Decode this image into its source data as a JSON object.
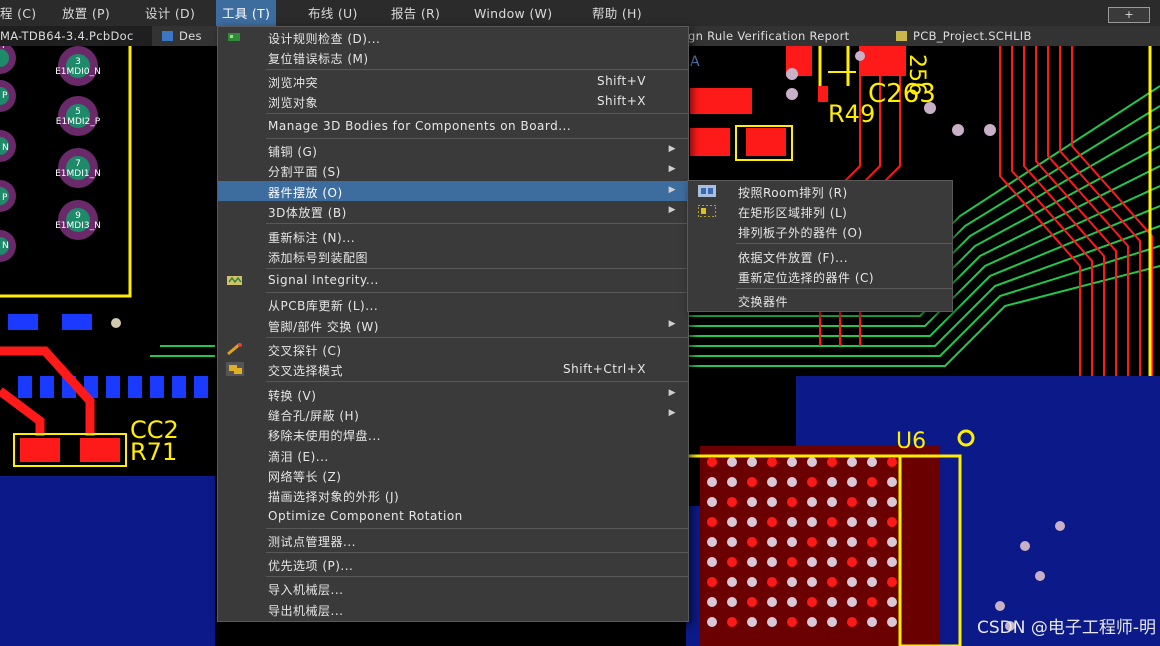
{
  "menubar": {
    "items": [
      "程 (C)",
      "放置 (P)",
      "设计 (D)",
      "工具 (T)",
      "布线 (U)",
      "报告 (R)",
      "Window (W)",
      "帮助 (H)"
    ],
    "window_button": "+"
  },
  "tabs": [
    {
      "label": "MA-TDB64-3.4.PcbDoc"
    },
    {
      "label": "Des"
    },
    {
      "label": "gn Rule Verification Report"
    },
    {
      "label": "PCB_Project.SCHLIB"
    }
  ],
  "tools_menu": {
    "items": [
      {
        "label": "设计规则检查 (D)...",
        "shortcut": "",
        "submenu": false
      },
      {
        "label": "复位错误标志 (M)",
        "shortcut": "",
        "submenu": false
      },
      {
        "label": "浏览冲突",
        "shortcut": "Shift+V",
        "submenu": false
      },
      {
        "label": "浏览对象",
        "shortcut": "Shift+X",
        "submenu": false
      },
      {
        "label": "Manage 3D Bodies for Components on Board...",
        "shortcut": "",
        "submenu": false
      },
      {
        "label": "铺铜 (G)",
        "shortcut": "",
        "submenu": true
      },
      {
        "label": "分割平面 (S)",
        "shortcut": "",
        "submenu": true
      },
      {
        "label": "器件摆放 (O)",
        "shortcut": "",
        "submenu": true
      },
      {
        "label": "3D体放置 (B)",
        "shortcut": "",
        "submenu": true
      },
      {
        "label": "重新标注 (N)...",
        "shortcut": "",
        "submenu": false
      },
      {
        "label": "添加标号到装配图",
        "shortcut": "",
        "submenu": false
      },
      {
        "label": "Signal Integrity...",
        "shortcut": "",
        "submenu": false
      },
      {
        "label": "从PCB库更新 (L)...",
        "shortcut": "",
        "submenu": false
      },
      {
        "label": "管脚/部件 交换 (W)",
        "shortcut": "",
        "submenu": true
      },
      {
        "label": "交叉探针 (C)",
        "shortcut": "",
        "submenu": false
      },
      {
        "label": "交叉选择模式",
        "shortcut": "Shift+Ctrl+X",
        "submenu": false
      },
      {
        "label": "转换 (V)",
        "shortcut": "",
        "submenu": true
      },
      {
        "label": "缝合孔/屏蔽 (H)",
        "shortcut": "",
        "submenu": true
      },
      {
        "label": "移除未使用的焊盘...",
        "shortcut": "",
        "submenu": false
      },
      {
        "label": "滴泪 (E)...",
        "shortcut": "",
        "submenu": false
      },
      {
        "label": "网络等长 (Z)",
        "shortcut": "",
        "submenu": false
      },
      {
        "label": "描画选择对象的外形 (J)",
        "shortcut": "",
        "submenu": false
      },
      {
        "label": "Optimize Component Rotation",
        "shortcut": "",
        "submenu": false
      },
      {
        "label": "测试点管理器...",
        "shortcut": "",
        "submenu": false
      },
      {
        "label": "优先选项 (P)...",
        "shortcut": "",
        "submenu": false
      },
      {
        "label": "导入机械层...",
        "shortcut": "",
        "submenu": false
      },
      {
        "label": "导出机械层...",
        "shortcut": "",
        "submenu": false
      }
    ]
  },
  "placement_submenu": {
    "items": [
      {
        "label": "按照Room排列 (R)"
      },
      {
        "label": "在矩形区域排列 (L)"
      },
      {
        "label": "排列板子外的器件 (O)"
      },
      {
        "label": "依据文件放置 (F)..."
      },
      {
        "label": "重新定位选择的器件 (C)"
      },
      {
        "label": "交换器件"
      }
    ]
  },
  "pcb_labels": {
    "r49": "R49",
    "c263": "C263",
    "c256": "256",
    "u6": "U6",
    "r71": "R71",
    "cc2": "CC2",
    "pad_a": "A",
    "pads": [
      {
        "num": "3",
        "net": "E1MDI0_N"
      },
      {
        "num": "5",
        "net": "E1MDI2_P"
      },
      {
        "num": "7",
        "net": "E1MDI1_N"
      },
      {
        "num": "9",
        "net": "E1MDI3_N"
      }
    ],
    "left_pads": [
      "P",
      "P",
      "N",
      "P",
      "N"
    ]
  },
  "colors": {
    "menu_bg": "#3a3a3a",
    "highlight": "#3d6c9e",
    "trace_red": "#ff1a1a",
    "trace_green": "#22c84a",
    "silk_yellow": "#ffee00",
    "pad_blue": "#1a3aff"
  },
  "watermark": "CSDN @电子工程师-明"
}
